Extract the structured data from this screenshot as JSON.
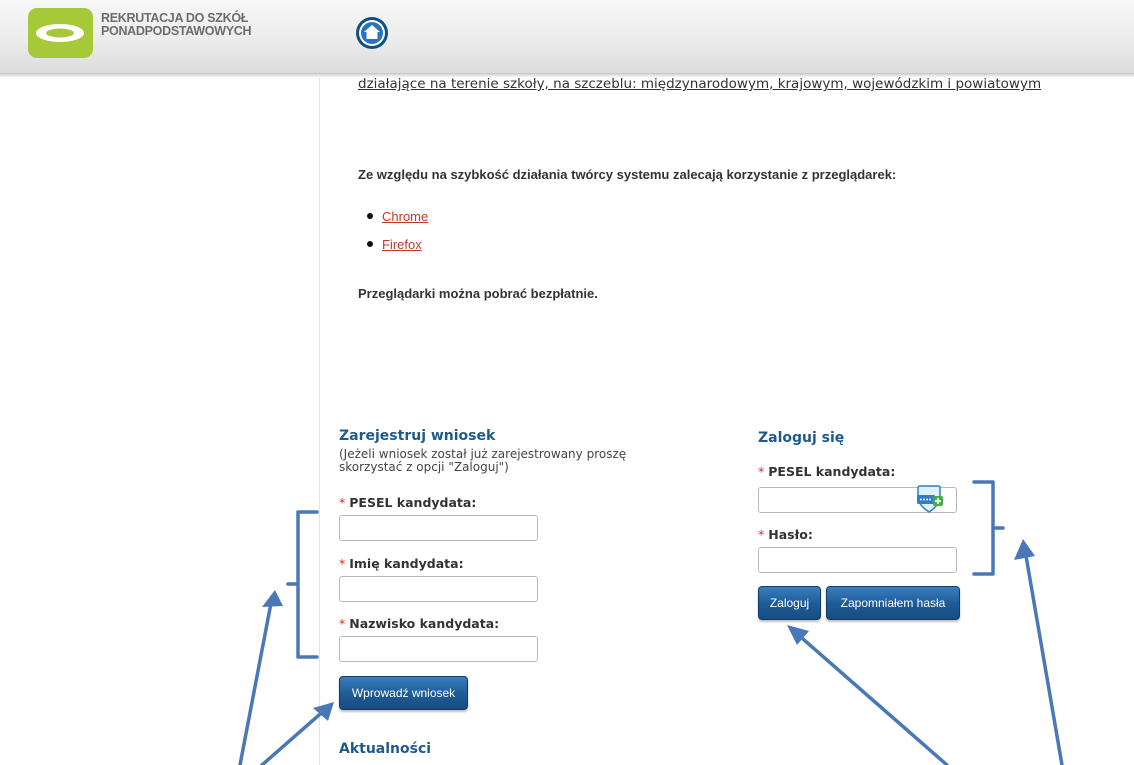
{
  "header": {
    "logo_line1": "REKRUTACJA DO SZKÓŁ",
    "logo_line2": "PONADPODSTAWOWYCH",
    "home_icon": "home-icon"
  },
  "content": {
    "org_text": "działające na terenie szkoły, na szczeblu: międzynarodowym, krajowym, wojewódzkim i powiatowym",
    "browser_recommendation": "Ze względu na szybkość działania twórcy systemu zalecają korzystanie z przeglądarek:",
    "browsers": [
      "Chrome",
      "Firefox"
    ],
    "free_download": "Przeglądarki można pobrać bezpłatnie."
  },
  "register": {
    "title": "Zarejestruj wniosek",
    "hint": "(Jeżeli wniosek został już zarejestrowany proszę skorzystać z opcji \"Zaloguj\")",
    "pesel_label": "PESEL kandydata:",
    "name_label": "Imię kandydata:",
    "surname_label": "Nazwisko kandydata:",
    "submit_label": "Wprowadź wniosek"
  },
  "login": {
    "title": "Zaloguj się",
    "pesel_label": "PESEL kandydata:",
    "password_label": "Hasło:",
    "login_button": "Zaloguj",
    "forgot_button": "Zapomniałem hasła"
  },
  "required_marker": "*",
  "news": {
    "title": "Aktualności"
  },
  "colors": {
    "brand_green": "#a5c939",
    "heading_blue": "#1f5a8e",
    "button_blue": "#1f5d98",
    "link_red": "#c0392b",
    "required_red": "#d0302b",
    "annotation_blue": "#4a78b6"
  }
}
